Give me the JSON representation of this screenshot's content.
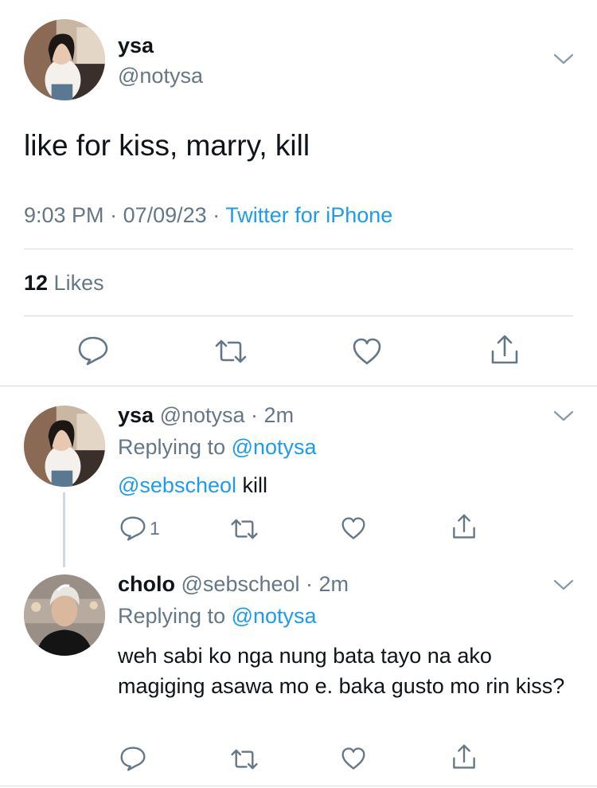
{
  "main_tweet": {
    "name": "ysa",
    "handle": "@notysa",
    "text": "like for kiss, marry, kill",
    "time": "9:03 PM",
    "sep1": " · ",
    "date": "07/09/23",
    "sep2": " · ",
    "source": "Twitter for iPhone",
    "likes_count": "12",
    "likes_label": " Likes"
  },
  "replies": [
    {
      "name": "ysa",
      "handle": "@notysa",
      "dot": " · ",
      "age": "2m",
      "replying_label": "Replying to ",
      "replying_to": "@notysa",
      "mention": "@sebscheol",
      "text": " kill",
      "reply_count": "1"
    },
    {
      "name": "cholo",
      "handle": "@sebscheol",
      "dot": " · ",
      "age": "2m",
      "replying_label": "Replying to ",
      "replying_to": "@notysa",
      "text": "weh sabi ko nga nung bata tayo na ako magiging asawa mo e. baka gusto mo rin kiss?",
      "reply_count": ""
    }
  ],
  "icons": {
    "reply": "reply-bubble-icon",
    "retweet": "retweet-icon",
    "like": "heart-icon",
    "share": "share-icon",
    "more": "chevron-down-icon"
  },
  "colors": {
    "link": "#1d9bf0",
    "secondary": "#657786",
    "divider": "#d6dce1"
  }
}
